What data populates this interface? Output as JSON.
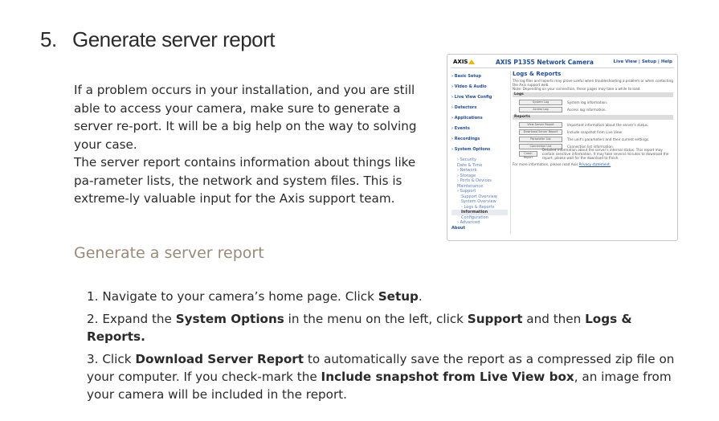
{
  "section": {
    "number": "5.",
    "title": "Generate server report"
  },
  "paragraphs": [
    "If a problem occurs in your installation, and you are still able to access your camera, make sure to generate a server re-port. It will be a big help on the way to solving your case.",
    "The server report contains information about things like pa-rameter lists, the network and system files. This is extreme-ly valuable input for the Axis support team."
  ],
  "subheading": "Generate a server report",
  "steps": [
    {
      "num": "1.",
      "parts": [
        {
          "t": "Navigate to your camera’s home page. Click "
        },
        {
          "t": "Setup",
          "b": true
        },
        {
          "t": "."
        }
      ]
    },
    {
      "num": "2.",
      "parts": [
        {
          "t": "Expand the "
        },
        {
          "t": "System Options",
          "b": true
        },
        {
          "t": " in the menu on the left, click "
        },
        {
          "t": "Support",
          "b": true
        },
        {
          "t": " and then "
        },
        {
          "t": "Logs & Reports.",
          "b": true
        }
      ]
    },
    {
      "num": "3.",
      "parts": [
        {
          "t": "Click "
        },
        {
          "t": "Download Server Report",
          "b": true
        },
        {
          "t": " to automatically save the report as a compressed zip file on your computer. If you check-mark the "
        },
        {
          "t": "Include snapshot from Live View box",
          "b": true
        },
        {
          "t": ", an image from your camera will be included in the report."
        }
      ]
    }
  ],
  "screenshot": {
    "logo": "AXIS",
    "camera_title": "AXIS P1355 Network Camera",
    "top_links": "Live View | Setup | Help",
    "menu": [
      {
        "label": "› Basic Setup",
        "level": 0
      },
      {
        "label": "› Video & Audio",
        "level": 0
      },
      {
        "label": "› Live View Config",
        "level": 0
      },
      {
        "label": "› Detectors",
        "level": 0
      },
      {
        "label": "› Applications",
        "level": 0
      },
      {
        "label": "› Events",
        "level": 0
      },
      {
        "label": "› Recordings",
        "level": 0
      },
      {
        "label": "› System Options",
        "level": 0
      },
      {
        "label": "› Security",
        "level": 1
      },
      {
        "label": "Date & Time",
        "level": 1
      },
      {
        "label": "› Network",
        "level": 1
      },
      {
        "label": "› Storage",
        "level": 1
      },
      {
        "label": "› Ports & Devices",
        "level": 1
      },
      {
        "label": "Maintenance",
        "level": 1
      },
      {
        "label": "› Support",
        "level": 1
      },
      {
        "label": "Support Overview",
        "level": 2
      },
      {
        "label": "System Overview",
        "level": 2
      },
      {
        "label": "› Logs & Reports",
        "level": 2
      },
      {
        "label": "Information",
        "level": 2,
        "selected": true
      },
      {
        "label": "Configuration",
        "level": 2
      },
      {
        "label": "› Advanced",
        "level": 1
      },
      {
        "label": "About",
        "level": 0
      }
    ],
    "content_title": "Logs & Reports",
    "content_intro": "The log files and reports may prove useful when troubleshooting a problem or when contacting the Axis support web.",
    "content_note": "Note: Depending on your connection, these pages may take a while to load.",
    "logs_header": "Logs",
    "logs_rows": [
      {
        "button": "System Log",
        "text": "System log information."
      },
      {
        "button": "Access Log",
        "text": "Access log information."
      }
    ],
    "reports_header": "Reports",
    "report_rows": [
      {
        "button": "View Server Report",
        "text": "Important information about the server's status."
      },
      {
        "button": "Download Server Report",
        "text": "Include snapshot from Live View"
      },
      {
        "button": "Parameter List",
        "text": "The unit's parameters and their current settings."
      },
      {
        "button": "Connection List",
        "text": "Connection list information."
      },
      {
        "button": "Crash Report",
        "text": "Detailed information about the server's internal status. This report may contain sensitive information. It may take several minutes to download the report, please wait for the download to finish."
      }
    ],
    "footer_text": "For more information, please read Axis",
    "footer_link": "Privacy statement."
  }
}
